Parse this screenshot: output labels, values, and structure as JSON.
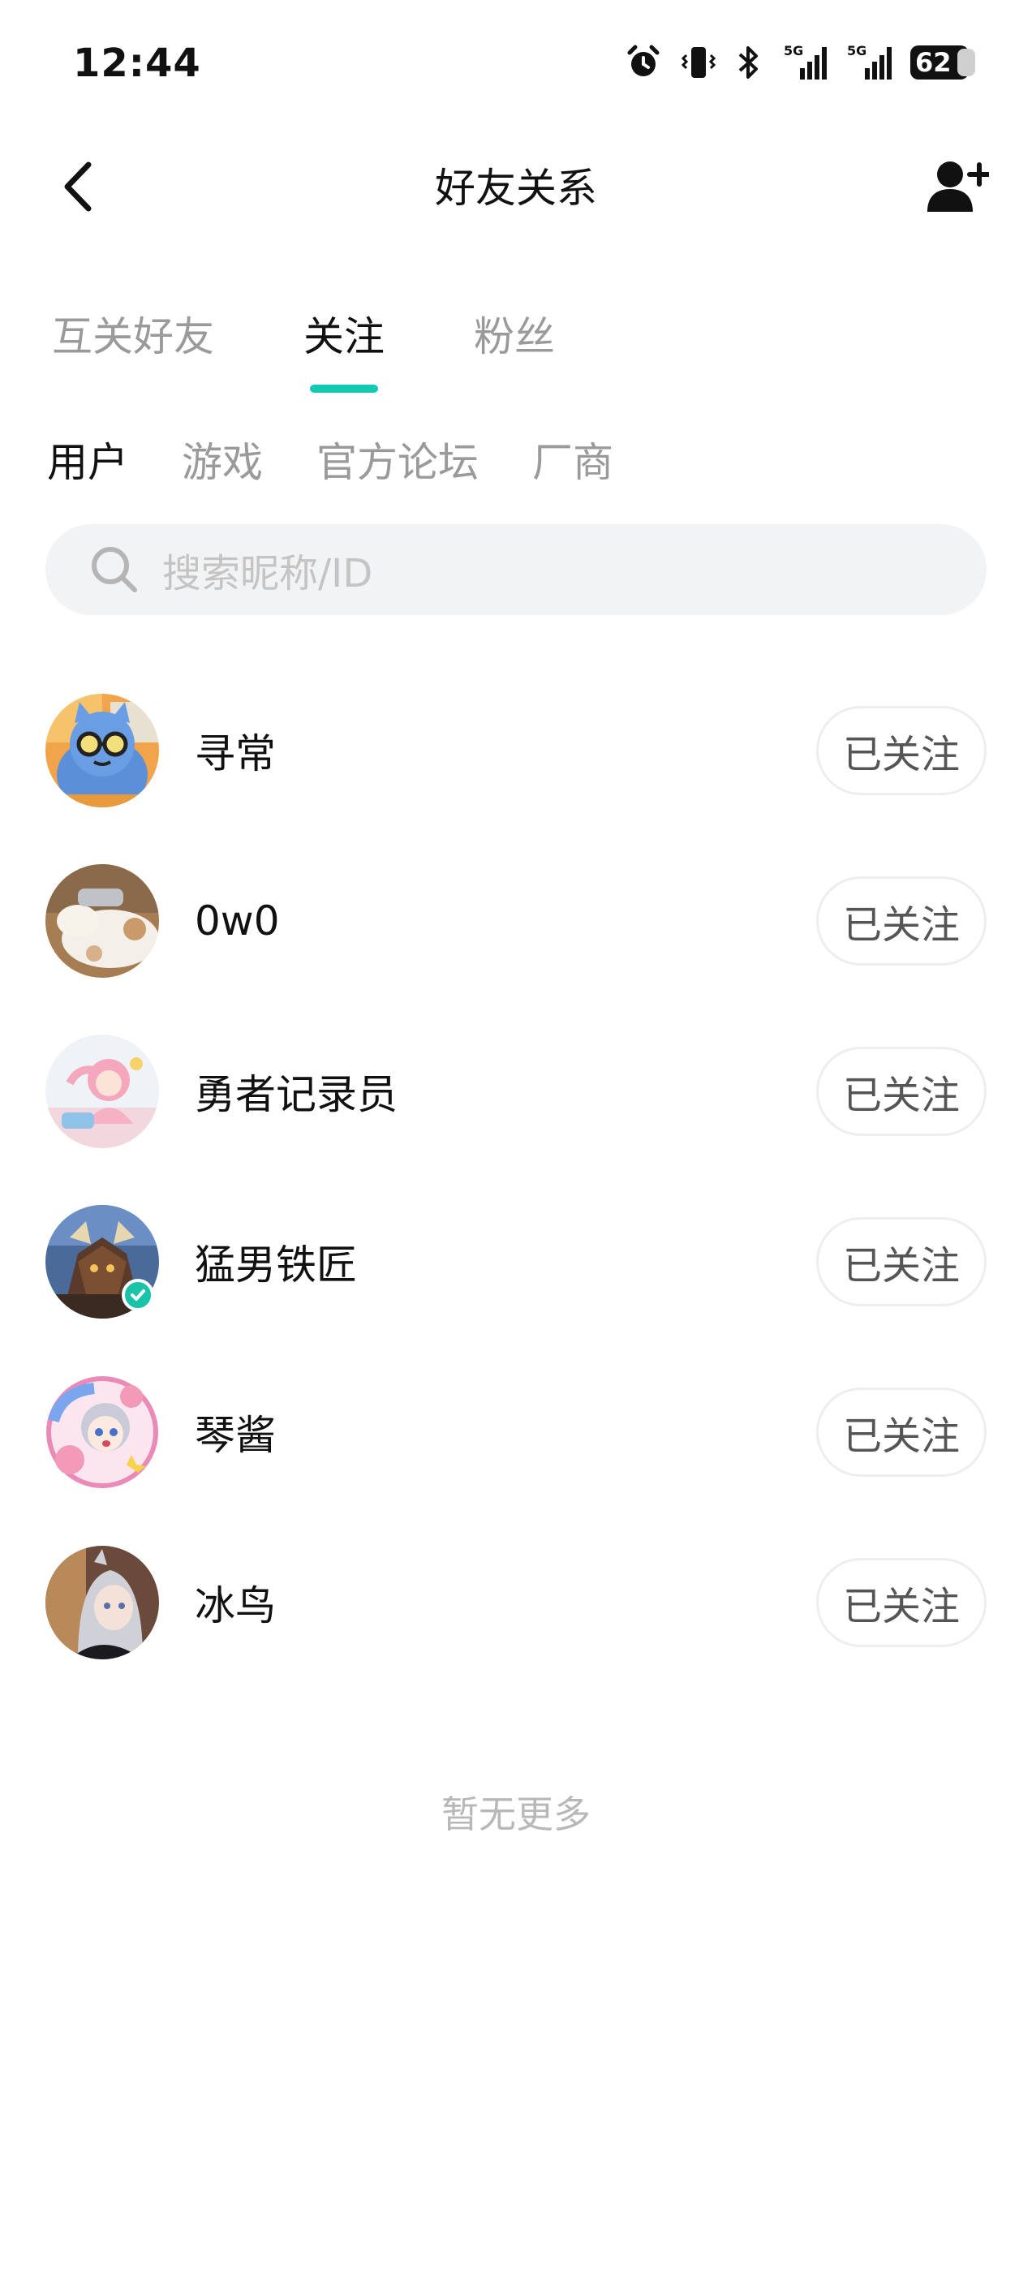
{
  "status_bar": {
    "time": "12:44",
    "battery": "62",
    "network_1": "5G",
    "network_2": "5G",
    "icons": [
      "alarm-icon",
      "vibrate-icon",
      "bluetooth-icon",
      "signal-icon",
      "signal-icon",
      "battery-icon"
    ]
  },
  "nav": {
    "title": "好友关系",
    "back_icon": "back-arrow-icon",
    "add_icon": "add-user-icon"
  },
  "main_tabs": [
    {
      "label": "互关好友",
      "active": false
    },
    {
      "label": "关注",
      "active": true
    },
    {
      "label": "粉丝",
      "active": false
    }
  ],
  "sub_tabs": [
    {
      "label": "用户",
      "active": true
    },
    {
      "label": "游戏",
      "active": false
    },
    {
      "label": "官方论坛",
      "active": false
    },
    {
      "label": "厂商",
      "active": false
    }
  ],
  "search": {
    "placeholder": "搜索昵称/ID",
    "value": ""
  },
  "users": [
    {
      "name": "寻常",
      "button": "已关注",
      "verified": false
    },
    {
      "name": "0w0",
      "button": "已关注",
      "verified": false
    },
    {
      "name": "勇者记录员",
      "button": "已关注",
      "verified": false
    },
    {
      "name": "猛男铁匠",
      "button": "已关注",
      "verified": true
    },
    {
      "name": "琴酱",
      "button": "已关注",
      "verified": false
    },
    {
      "name": "冰鸟",
      "button": "已关注",
      "verified": false
    }
  ],
  "footer": {
    "no_more": "暂无更多"
  },
  "colors": {
    "accent": "#14c9b4",
    "verified": "#19c3a8",
    "muted_text": "#9a9a9a",
    "search_bg": "#f2f3f5"
  }
}
